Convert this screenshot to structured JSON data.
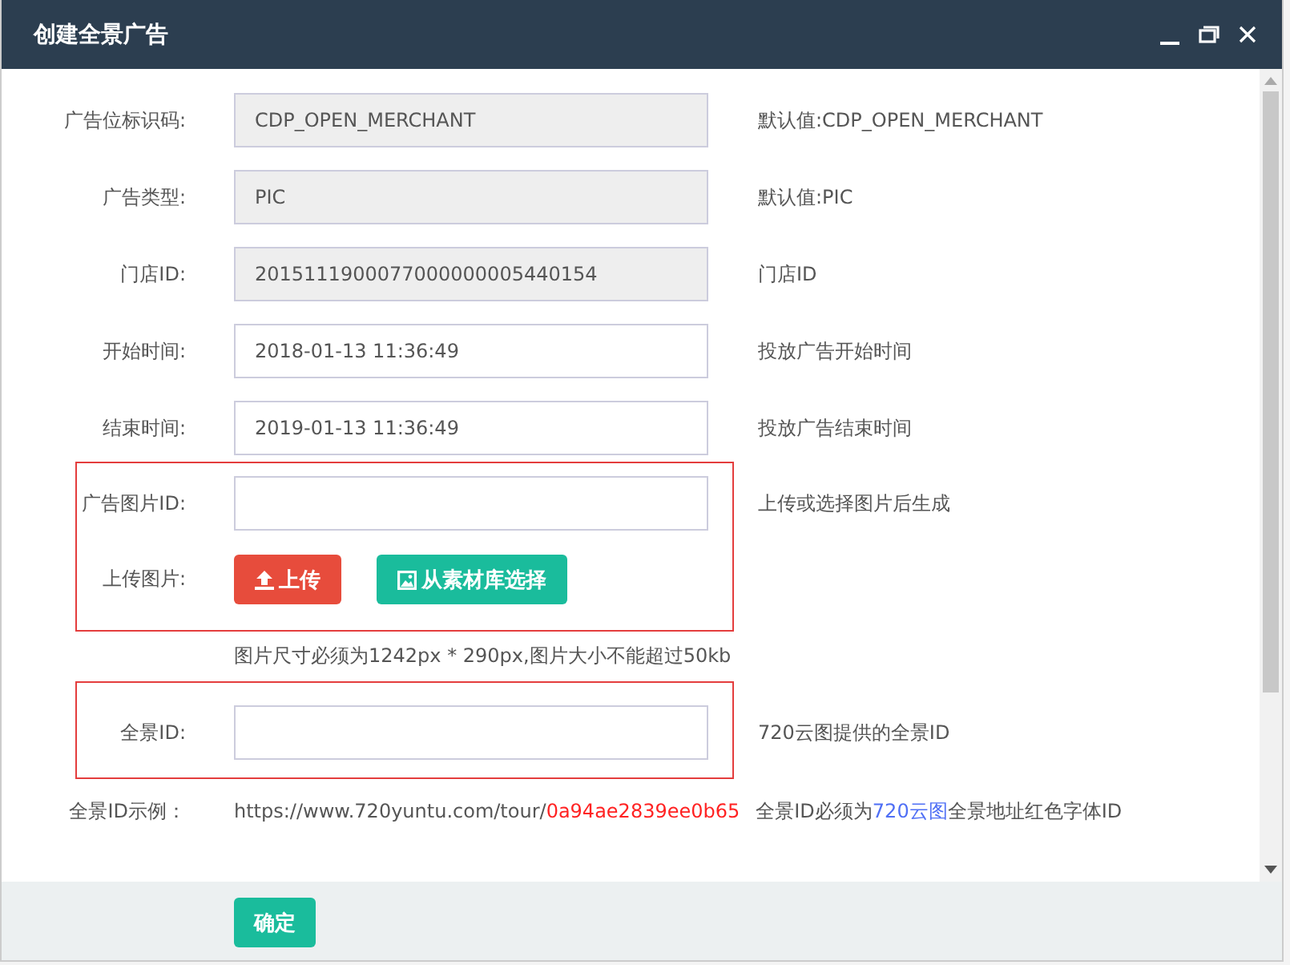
{
  "window": {
    "title": "创建全景广告"
  },
  "sections": [
    {
      "highlighted": false,
      "rows": [
        {
          "kind": "input",
          "label": "广告位标识码:",
          "value": "CDP_OPEN_MERCHANT",
          "readonly": true,
          "hint": "默认值:CDP_OPEN_MERCHANT"
        },
        {
          "kind": "input",
          "label": "广告类型:",
          "value": "PIC",
          "readonly": true,
          "hint": "默认值:PIC"
        },
        {
          "kind": "input",
          "label": "门店ID:",
          "value": "2015111900077000000005440154",
          "readonly": true,
          "hint": "门店ID"
        },
        {
          "kind": "input",
          "label": "开始时间:",
          "value": "2018-01-13 11:36:49",
          "readonly": false,
          "hint": "投放广告开始时间"
        },
        {
          "kind": "input",
          "label": "结束时间:",
          "value": "2019-01-13 11:36:49",
          "readonly": false,
          "hint": "投放广告结束时间"
        }
      ]
    },
    {
      "highlighted": true,
      "rows": [
        {
          "kind": "input",
          "label": "广告图片ID:",
          "readonly": false,
          "hint": "上传或选择图片后生成"
        },
        {
          "kind": "upload",
          "label": "上传图片:",
          "buttons": [
            {
              "kind": "upload",
              "label": "上传"
            },
            {
              "kind": "library",
              "label": "从素材库选择"
            }
          ]
        }
      ]
    },
    {
      "highlighted": false,
      "rows": [
        {
          "kind": "note",
          "text": "图片尺寸必须为1242px * 290px,图片大小不能超过50kb"
        }
      ]
    },
    {
      "highlighted": true,
      "rows": [
        {
          "kind": "input",
          "label": "全景ID:",
          "readonly": false,
          "hint": "720云图提供的全景ID"
        }
      ]
    },
    {
      "highlighted": false,
      "rows": [
        {
          "kind": "example",
          "label": "全景ID示例：",
          "url": "https://www.720yuntu.com/tour/",
          "url_id": "0a94ae2839ee0b65",
          "notice_before": "全景ID必须为",
          "notice_link": "720云图",
          "notice_after": "全景地址红色字体ID"
        }
      ]
    }
  ],
  "footer": {
    "confirm": "确定"
  }
}
